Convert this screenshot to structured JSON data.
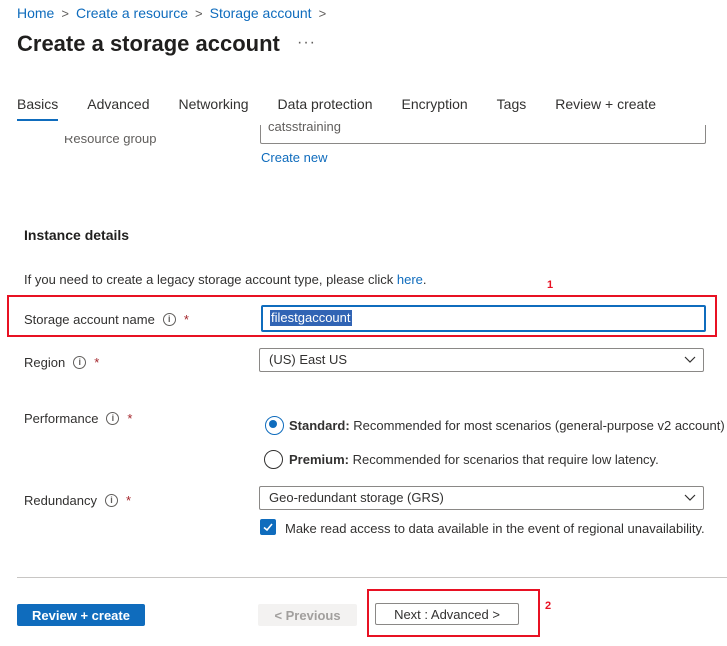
{
  "breadcrumb": {
    "items": [
      "Home",
      "Create a resource",
      "Storage account"
    ]
  },
  "page_title": "Create a storage account",
  "more_label": "···",
  "tabs": [
    {
      "label": "Basics",
      "active": true
    },
    {
      "label": "Advanced",
      "active": false
    },
    {
      "label": "Networking",
      "active": false
    },
    {
      "label": "Data protection",
      "active": false
    },
    {
      "label": "Encryption",
      "active": false
    },
    {
      "label": "Tags",
      "active": false
    },
    {
      "label": "Review + create",
      "active": false
    }
  ],
  "resource_group": {
    "label": "Resource group",
    "value": "catsstraining",
    "create_new": "Create new"
  },
  "instance_details": {
    "heading": "Instance details",
    "legacy_text": "If you need to create a legacy storage account type, please click ",
    "legacy_link": "here",
    "legacy_suffix": "."
  },
  "storage_account_name": {
    "label": "Storage account name",
    "value": "filestgaccount",
    "required": "*"
  },
  "region": {
    "label": "Region",
    "value": "(US) East US",
    "required": "*"
  },
  "performance": {
    "label": "Performance",
    "required": "*",
    "options": [
      {
        "title": "Standard:",
        "description": " Recommended for most scenarios (general-purpose v2 account)",
        "checked": true
      },
      {
        "title": "Premium:",
        "description": " Recommended for scenarios that require low latency.",
        "checked": false
      }
    ]
  },
  "redundancy": {
    "label": "Redundancy",
    "value": "Geo-redundant storage (GRS)",
    "required": "*",
    "read_access_label": "Make read access to data available in the event of regional unavailability.",
    "read_access_checked": true
  },
  "footer": {
    "review_create": "Review + create",
    "previous": "< Previous",
    "next": "Next : Advanced >"
  },
  "annotations": {
    "one": "1",
    "two": "2",
    "color": "#e81123"
  },
  "colors": {
    "accent": "#0f6cbd",
    "required": "#a4262c"
  }
}
